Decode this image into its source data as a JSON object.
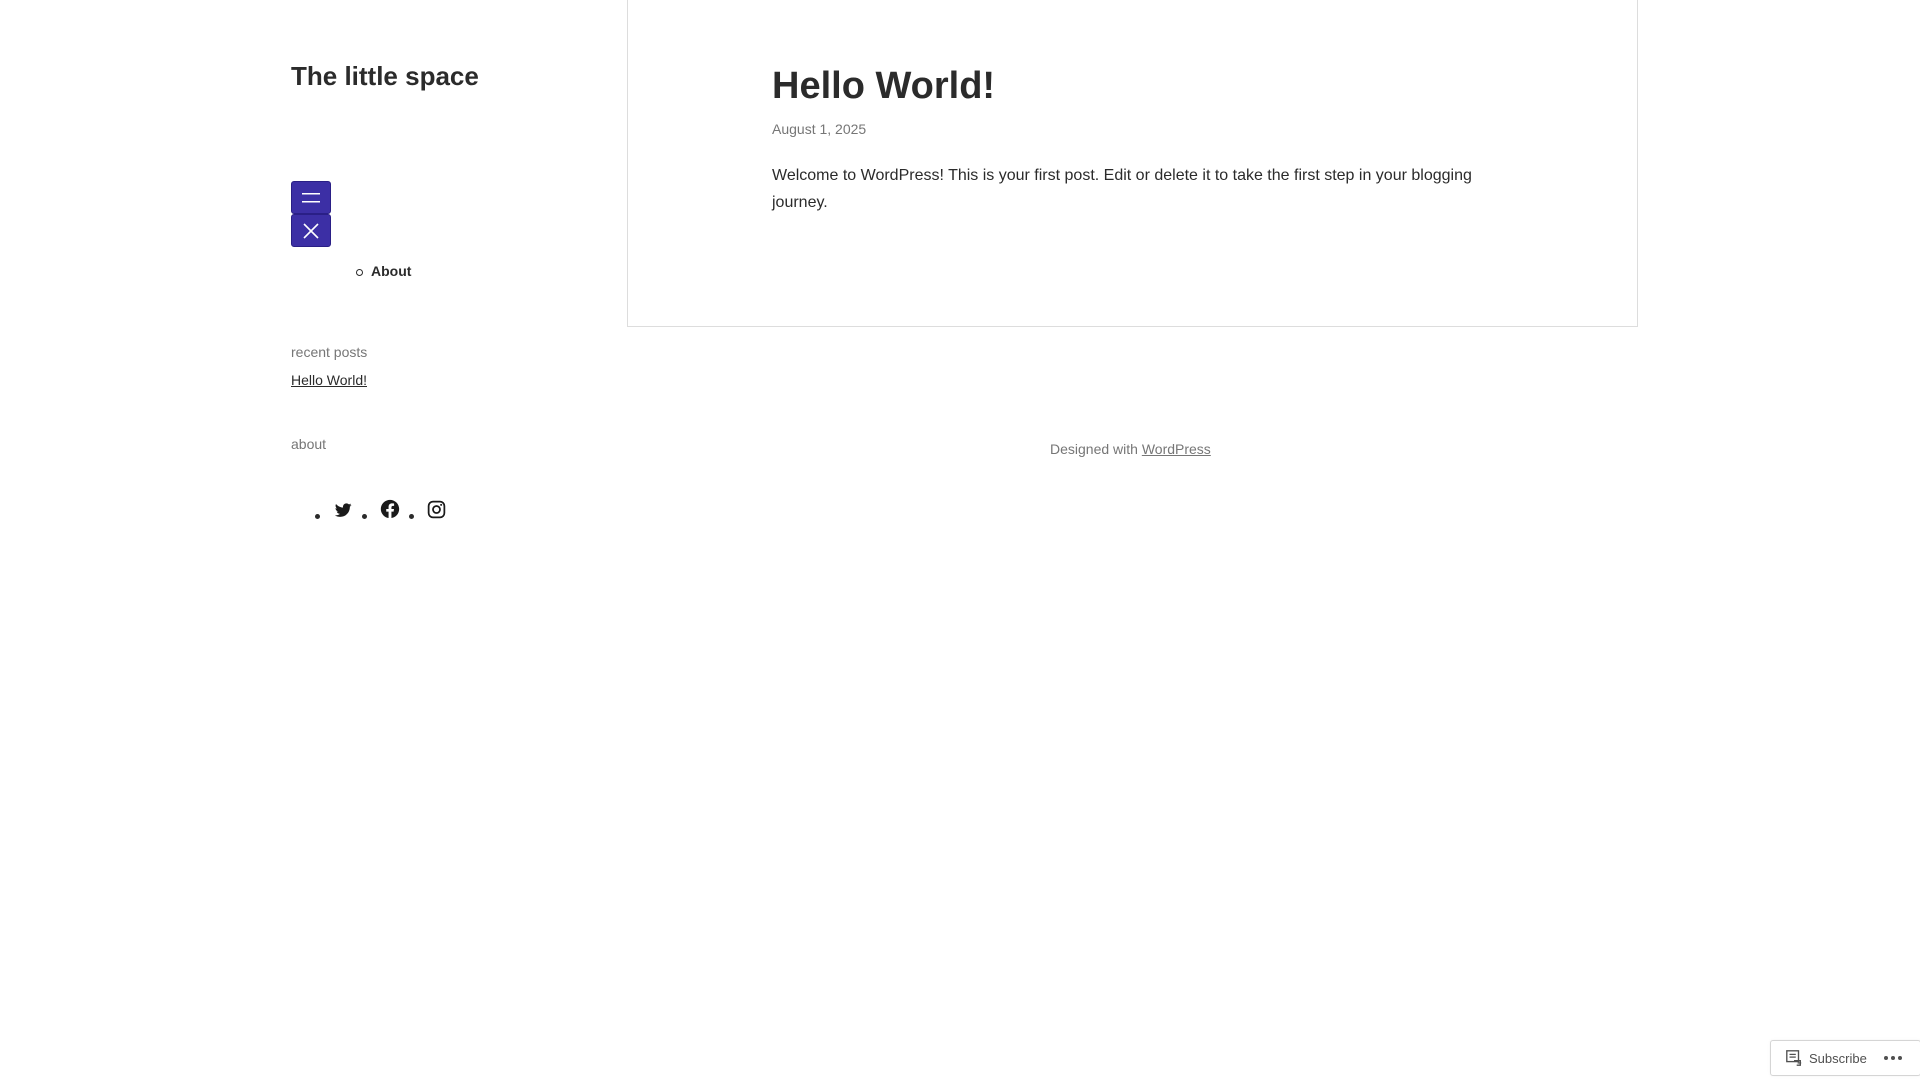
{
  "site": {
    "title": "The little space"
  },
  "navigation": {
    "open_button_icon": "hamburger-menu-icon",
    "close_button_icon": "close-icon",
    "items": [
      {
        "label": "About"
      }
    ]
  },
  "widgets": {
    "recent_posts": {
      "title": "recent posts",
      "items": [
        {
          "label": "Hello World!"
        }
      ]
    },
    "about": {
      "title": "about",
      "social_icons": [
        "twitter-icon",
        "facebook-icon",
        "instagram-icon"
      ]
    }
  },
  "post": {
    "title": "Hello World!",
    "date": "August 1, 2025",
    "content": "Welcome to WordPress! This is your first post. Edit or delete it to take the first step in your blogging journey."
  },
  "footer": {
    "prefix": "Designed with ",
    "link_label": "WordPress"
  },
  "subscribe_bar": {
    "subscribe_label": "Subscribe",
    "subscribe_icon": "reader-icon",
    "more_icon": "ellipsis-icon"
  },
  "colors": {
    "accent": "#3c2fa5",
    "text": "#2b2b2b",
    "muted": "#767676",
    "border": "#dddddd"
  }
}
